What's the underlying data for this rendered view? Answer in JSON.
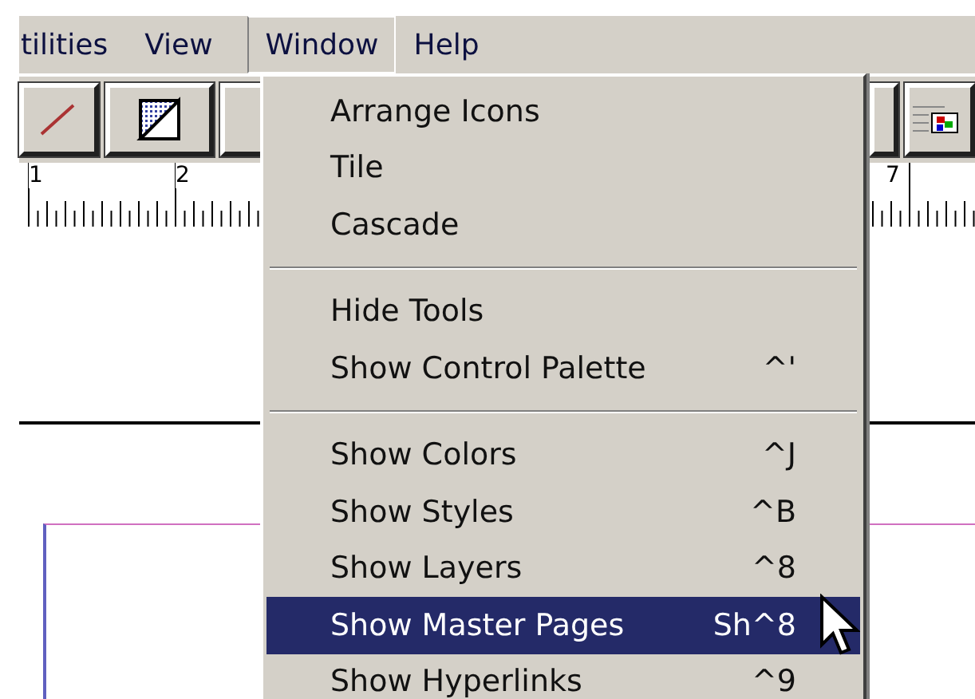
{
  "menubar": [
    {
      "label": "tilities",
      "selected": false
    },
    {
      "label": "View",
      "selected": false
    },
    {
      "label": "Window",
      "selected": true
    },
    {
      "label": "Help",
      "selected": false
    }
  ],
  "ruler": {
    "labels": [
      "1",
      "2",
      "7"
    ]
  },
  "menu": {
    "items": [
      {
        "kind": "item",
        "label": "Arrange Icons",
        "selected": false
      },
      {
        "kind": "item",
        "label": "Tile",
        "selected": false
      },
      {
        "kind": "item",
        "label": "Cascade",
        "selected": false
      },
      {
        "kind": "separator"
      },
      {
        "kind": "item",
        "label": "Hide Tools",
        "selected": false
      },
      {
        "kind": "item",
        "label": "Show Control Palette",
        "shortcut": "^'",
        "selected": false
      },
      {
        "kind": "separator"
      },
      {
        "kind": "item",
        "label": "Show Colors",
        "shortcut": "^J",
        "selected": false
      },
      {
        "kind": "item",
        "label": "Show Styles",
        "shortcut": "^B",
        "selected": false
      },
      {
        "kind": "item",
        "label": "Show Layers",
        "shortcut": "^8",
        "selected": false
      },
      {
        "kind": "item",
        "label": "Show Master Pages",
        "shortcut": "Sh^8",
        "selected": true
      },
      {
        "kind": "item",
        "label": "Show Hyperlinks",
        "shortcut": "^9",
        "selected": false
      }
    ]
  }
}
